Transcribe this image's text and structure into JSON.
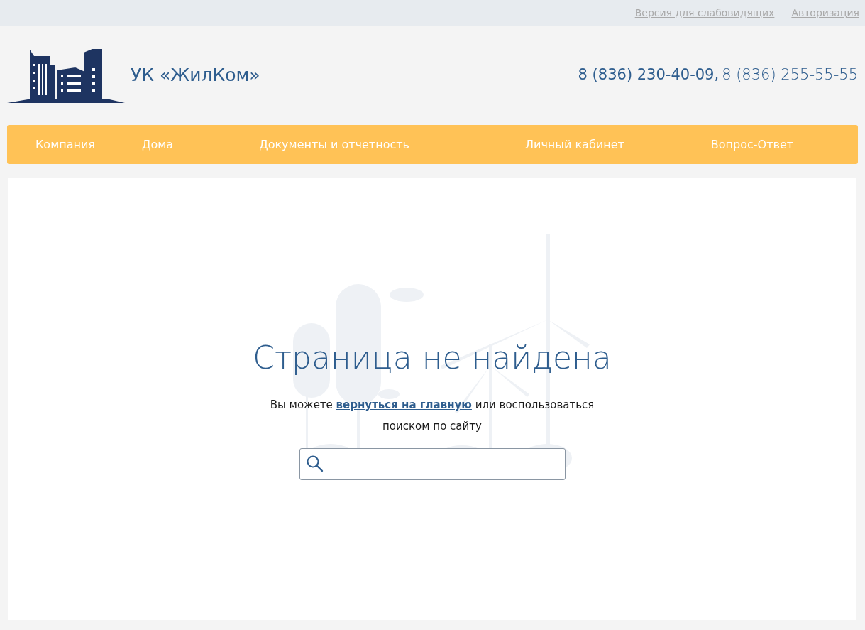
{
  "top_links": [
    {
      "label": "Версия для слабовидящих"
    },
    {
      "label": "Авторизация"
    }
  ],
  "header": {
    "logo_text": "УК «ЖилКом»",
    "phones": [
      "8 (836) 230-40-09,",
      "8 (836) 255-55-55"
    ]
  },
  "nav": [
    {
      "label": "Компания"
    },
    {
      "label": "Дома"
    },
    {
      "label": "Документы и отчетность"
    },
    {
      "label": "Личный кабинет"
    },
    {
      "label": "Вопрос-Ответ"
    }
  ],
  "content": {
    "title": "Страница не найдена",
    "message_before": "Вы можете",
    "message_link": "вернуться на главную",
    "message_after": "или воспользоваться поиском по сайту"
  }
}
